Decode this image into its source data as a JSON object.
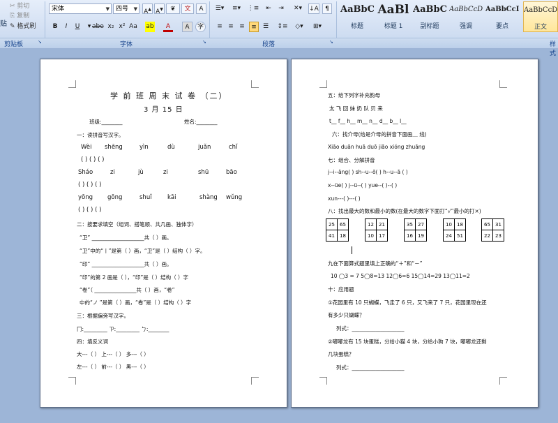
{
  "ribbon": {
    "clipboard": {
      "paste": "贴",
      "cut": "剪切",
      "copy": "复制",
      "format_painter": "格式刷",
      "label": "剪贴板"
    },
    "font": {
      "name": "宋体",
      "size": "四号",
      "label": "字体",
      "buttons": [
        "B",
        "I",
        "U",
        "abe",
        "x₂",
        "x²",
        "Aa",
        "A",
        "A",
        "Aa"
      ]
    },
    "paragraph": {
      "label": "段落"
    },
    "styles": {
      "label": "样式",
      "items": [
        {
          "sample": "AaBbC",
          "name": "标题"
        },
        {
          "sample": "AaBl",
          "name": "标题 1"
        },
        {
          "sample": "AaBbC",
          "name": "副标题"
        },
        {
          "sample": "AaBbCcD",
          "name": "强调"
        },
        {
          "sample": "AaBbCcD",
          "name": "要点"
        },
        {
          "sample": "AaBbCcDc",
          "name": "正文"
        }
      ]
    }
  },
  "page1": {
    "title": "学 前 班 周 末 试 卷 （二）",
    "date": "3 月 15 日",
    "class_label": "班级:________",
    "name_label": "姓名:________",
    "s1": "一：读拼音写汉字。",
    "py_row1": [
      "Wèi",
      "shēng",
      "yìn",
      "dù",
      "juǎn",
      "chǐ"
    ],
    "py_row2": [
      "Sháo",
      "zi",
      "jù",
      "zi",
      "shū",
      "bāo"
    ],
    "py_row3": [
      "yōng",
      "gōng",
      "shuǐ",
      "kāi",
      "shàng",
      "wǔng"
    ],
    "paren_row": "(             )   (             )   (             )",
    "s2": "二：按要求填空（组词、搭笔顺、共几画、独体字）",
    "l1": "“卫” ____________________共（      ）画。",
    "l2": "“卫”中的“丨”是第（    ）画，“卫”是（    ）结构（    ）字。",
    "l3": "“印” ____________________共（      ）画。",
    "l4": "“印”的第 2 画是（    ），“印”是（    ）结构（    ）字",
    "l5": "“卷”（ ________________共（      ）画，“卷”",
    "l6": "中的“ノ ”是第（    ）画，“卷”是（    ）结构（    ）字",
    "s3": "三：根据偏旁写汉字。",
    "l7": "冂:_________  ㄗ:_________  ㄅ:________",
    "s4": "四：填反义词",
    "l8": "大---（    ）   上---（    ）    多---（    ）",
    "l9": "左---（    ）   前---（    ）    黑---（    ）"
  },
  "page2": {
    "s5": "五：给下列字补充韵母",
    "chars": "太      飞      回      妹      奶      队      贝      来",
    "blanks": "t__    f__    h__    m__    n__    d__    b__    l__",
    "s6": "六：找介母(给是介母的拼音下面画＿ 线)",
    "pinyin_row": "Xiāo     duān  huā   duō jiāo   xióng   zhuāng",
    "s7": "七：组合、分解拼音",
    "c1": "j--i--āng(     )     sh--u--ō(     )   h--u--ā (     )",
    "c2": "x--üe(    )      j--ü--(    )      yue--(     )--(     )",
    "c3": "xun---(     )---(     )",
    "s8": "八：找出最大的数和最小的数(在最大的数字下面打“√”最小的打×)",
    "grids": [
      [
        25,
        65,
        41,
        18
      ],
      [
        12,
        21,
        10,
        17
      ],
      [
        35,
        27,
        16,
        19
      ],
      [
        10,
        18,
        24,
        51
      ],
      [
        65,
        31,
        22,
        23
      ]
    ],
    "s9": "九在下面算式题里填上正确的“＋”和“－”",
    "math": "10 ◯3 = 7      5◯8=13    12◯6=6    15◯14=29    13◯11=2",
    "s10": "十：应用题",
    "q1a": "①花园里有 10 只蝴蝶，飞走了 6 只，又飞来了 7 只，花园里现在还",
    "q1b": "有多少只蝴蝶？",
    "ans1": "列式：____________________",
    "q2a": "②嘟嘟龙有 15 块蛋糕，分给小猫 4 块，分给小狗 7 块，嘟嘟龙还剩",
    "q2b": "几块蛋糕？",
    "ans2": "列式：____________________"
  }
}
